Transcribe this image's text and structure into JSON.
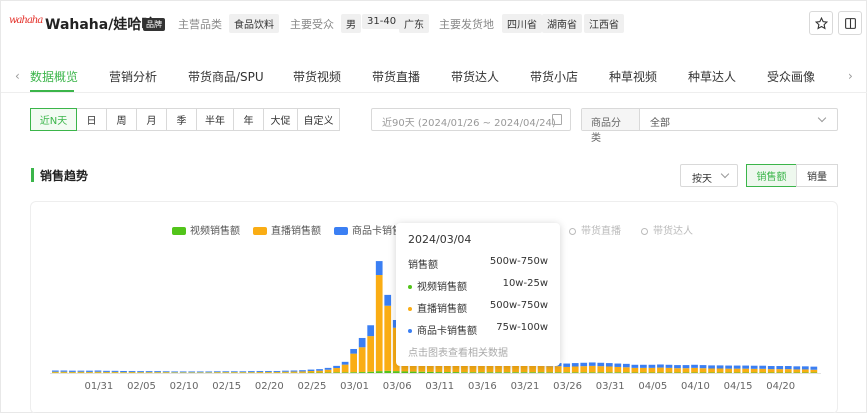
{
  "header": {
    "logo_text": "wahaha",
    "brand_name": "Wahaha/娃哈哈",
    "brand_badge": "品牌",
    "main_category_label": "主营品类",
    "main_category_tag": "食品饮料",
    "audience_label": "主要受众",
    "audience_tags": [
      "男",
      "31-40",
      "广东"
    ],
    "ship_label": "主要发货地",
    "ship_tags": [
      "四川省",
      "湖南省",
      "江西省"
    ],
    "favorite_icon": "star-icon",
    "layout_icon": "split-panel-icon"
  },
  "tabs": {
    "items": [
      "数据概览",
      "营销分析",
      "带货商品/SPU",
      "带货视频",
      "带货直播",
      "带货达人",
      "带货小店",
      "种草视频",
      "种草达人",
      "受众画像"
    ],
    "active_index": 0,
    "prev_icon": "‹",
    "next_icon": "›"
  },
  "filters": {
    "periods": [
      "近N天",
      "日",
      "周",
      "月",
      "季",
      "半年",
      "年",
      "大促",
      "自定义"
    ],
    "active_period": 0,
    "date_range": "近90天 (2024/01/26 ~ 2024/04/24)",
    "category_label": "商品分类",
    "category_value": "全部"
  },
  "section": {
    "title": "销售趋势",
    "granularity": "按天",
    "metrics": [
      "销售额",
      "销量"
    ],
    "active_metric": 0
  },
  "legend": {
    "series": [
      {
        "name": "视频销售额",
        "color": "#52c41a"
      },
      {
        "name": "直播销售额",
        "color": "#faad14"
      },
      {
        "name": "商品卡销售额",
        "color": "#3b7ff3"
      }
    ],
    "toggles": [
      "带货直播",
      "带货达人"
    ]
  },
  "tooltip": {
    "date": "2024/03/04",
    "total_label": "销售额",
    "total_value": "500w-750w",
    "rows": [
      {
        "label": "视频销售额",
        "value": "10w-25w",
        "color": "#52c41a"
      },
      {
        "label": "直播销售额",
        "value": "500w-750w",
        "color": "#faad14"
      },
      {
        "label": "商品卡销售额",
        "value": "75w-100w",
        "color": "#3b7ff3"
      }
    ],
    "hint": "点击图表查看相关数据"
  },
  "chart_data": {
    "type": "bar",
    "stacked": true,
    "x_tick_labels": [
      "01/31",
      "02/05",
      "02/10",
      "02/15",
      "02/20",
      "02/25",
      "03/01",
      "03/06",
      "03/11",
      "03/16",
      "03/21",
      "03/26",
      "03/31",
      "04/05",
      "04/10",
      "04/15",
      "04/20"
    ],
    "categories": [
      "01/26",
      "01/27",
      "01/28",
      "01/29",
      "01/30",
      "01/31",
      "02/01",
      "02/02",
      "02/03",
      "02/04",
      "02/05",
      "02/06",
      "02/07",
      "02/08",
      "02/09",
      "02/10",
      "02/11",
      "02/12",
      "02/13",
      "02/14",
      "02/15",
      "02/16",
      "02/17",
      "02/18",
      "02/19",
      "02/20",
      "02/21",
      "02/22",
      "02/23",
      "02/24",
      "02/25",
      "02/26",
      "02/27",
      "02/28",
      "02/29",
      "03/01",
      "03/02",
      "03/03",
      "03/04",
      "03/05",
      "03/06",
      "03/07",
      "03/08",
      "03/09",
      "03/10",
      "03/11",
      "03/12",
      "03/13",
      "03/14",
      "03/15",
      "03/16",
      "03/17",
      "03/18",
      "03/19",
      "03/20",
      "03/21",
      "03/22",
      "03/23",
      "03/24",
      "03/25",
      "03/26",
      "03/27",
      "03/28",
      "03/29",
      "03/30",
      "03/31",
      "04/01",
      "04/02",
      "04/03",
      "04/04",
      "04/05",
      "04/06",
      "04/07",
      "04/08",
      "04/09",
      "04/10",
      "04/11",
      "04/12",
      "04/13",
      "04/14",
      "04/15",
      "04/16",
      "04/17",
      "04/18",
      "04/19",
      "04/20",
      "04/21",
      "04/22",
      "04/23",
      "04/24"
    ],
    "series": [
      {
        "name": "视频销售额",
        "values": [
          2,
          2,
          2,
          2,
          2,
          2,
          2,
          2,
          2,
          2,
          2,
          2,
          2,
          2,
          2,
          2,
          2,
          2,
          2,
          2,
          2,
          2,
          2,
          2,
          2,
          2,
          2,
          2,
          2,
          2,
          3,
          3,
          3,
          4,
          4,
          5,
          6,
          8,
          12,
          14,
          12,
          10,
          9,
          8,
          7,
          6,
          6,
          6,
          5,
          5,
          5,
          5,
          5,
          5,
          5,
          5,
          5,
          5,
          4,
          4,
          4,
          4,
          4,
          4,
          4,
          4,
          4,
          4,
          3,
          3,
          3,
          3,
          3,
          3,
          3,
          3,
          3,
          3,
          3,
          3,
          3,
          3,
          3,
          3,
          3,
          3,
          3,
          3,
          3,
          3
        ]
      },
      {
        "name": "直播销售额",
        "values": [
          6,
          6,
          5,
          6,
          5,
          6,
          5,
          5,
          4,
          5,
          4,
          4,
          4,
          4,
          3,
          3,
          3,
          3,
          3,
          4,
          4,
          4,
          4,
          4,
          5,
          5,
          5,
          6,
          7,
          8,
          10,
          12,
          18,
          28,
          50,
          120,
          160,
          230,
          620,
          420,
          280,
          200,
          150,
          120,
          100,
          90,
          80,
          70,
          65,
          60,
          55,
          50,
          50,
          48,
          45,
          45,
          42,
          40,
          40,
          40,
          35,
          38,
          40,
          42,
          40,
          38,
          35,
          33,
          30,
          30,
          30,
          32,
          30,
          28,
          28,
          30,
          28,
          26,
          26,
          25,
          25,
          25,
          24,
          24,
          22,
          22,
          22,
          20,
          20,
          18
        ]
      },
      {
        "name": "商品卡销售额",
        "values": [
          8,
          8,
          8,
          7,
          8,
          8,
          7,
          7,
          7,
          6,
          6,
          6,
          6,
          5,
          5,
          5,
          5,
          5,
          5,
          5,
          5,
          5,
          5,
          6,
          6,
          6,
          6,
          7,
          7,
          8,
          9,
          10,
          12,
          14,
          18,
          30,
          60,
          70,
          90,
          70,
          50,
          40,
          35,
          30,
          28,
          26,
          25,
          24,
          23,
          22,
          22,
          21,
          20,
          20,
          20,
          20,
          20,
          20,
          20,
          20,
          22,
          22,
          22,
          22,
          22,
          22,
          22,
          22,
          20,
          20,
          20,
          20,
          20,
          20,
          20,
          20,
          20,
          20,
          20,
          20,
          20,
          20,
          20,
          20,
          20,
          20,
          20,
          20,
          20,
          20
        ]
      }
    ]
  }
}
